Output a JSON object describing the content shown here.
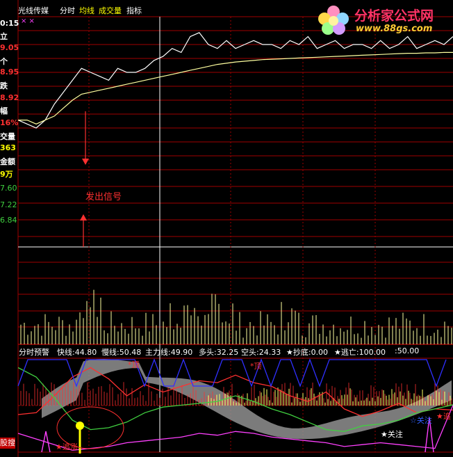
{
  "header": {
    "stock_name": "光线传媒",
    "tabs": [
      {
        "label": "分时",
        "color": "#ffffff"
      },
      {
        "label": "均线",
        "color": "#ffff00"
      },
      {
        "label": "成交量",
        "color": "#ffff00"
      },
      {
        "label": "指标",
        "color": "#ffffff"
      }
    ],
    "markers": "×    ×"
  },
  "watermark": {
    "title": "分析家公式网",
    "url": "www.88gs.com"
  },
  "left_panel": {
    "time": "0:15",
    "label_a": "立",
    "price_high": "9.05",
    "label_b": "个",
    "price_mid": "8.95",
    "label_c": "跌",
    "price_low": "8.92",
    "label_d": "幅",
    "change_pct": "16%",
    "volume_label": "交量",
    "volume_value": "363",
    "amount_label": "金额",
    "amount_value": "9万",
    "scale_1": "7.60",
    "scale_2": "7.22",
    "scale_3": "6.84",
    "button": "股搜"
  },
  "annotations": {
    "signal_text": "发出信号",
    "top_1": "*顶",
    "top_2": "*顶",
    "watch": "★关注",
    "chase": "★追涨",
    "chase_right": "★追",
    "bottom_right": "☆关注"
  },
  "legend": [
    {
      "text": "分时预警",
      "color": "#ffffff"
    },
    {
      "text": "快线:44.80",
      "color": "#ffffff"
    },
    {
      "text": "慢线:50.48",
      "color": "#ffffff"
    },
    {
      "text": "主力线:49.90",
      "color": "#ffffff"
    },
    {
      "text": "多头:32.25",
      "color": "#ffffff"
    },
    {
      "text": "空头:24.33",
      "color": "#ffffff"
    },
    {
      "text": "★抄底:0.00",
      "color": "#ffffff"
    },
    {
      "text": "★逃亡:100.00",
      "color": "#ffffff"
    },
    {
      "text": ":50.00",
      "color": "#ffffff"
    }
  ],
  "colors": {
    "background": "#000000",
    "grid": "#a00000",
    "price_line": "#ffffff",
    "avg_line": "#ffffa0",
    "volume": "#ffffa0",
    "fast_line": "#ff3030",
    "slow_line": "#40d040",
    "main_line": "#ff40ff",
    "band": "#909090",
    "blue_line": "#3030ff"
  },
  "chart_data": [
    {
      "type": "line",
      "name": "intraday price",
      "x": [
        0,
        5,
        10,
        15,
        20,
        25,
        30,
        35,
        40,
        45,
        50,
        55,
        60,
        65,
        70,
        75,
        80,
        85,
        90,
        95,
        100,
        105,
        110,
        115,
        120,
        125,
        130,
        135,
        140,
        145,
        150,
        155,
        160,
        165,
        170,
        175,
        180,
        185,
        190,
        195,
        200,
        205,
        210,
        215,
        220,
        225,
        230,
        235,
        240
      ],
      "series": [
        {
          "values": [
            8.84,
            8.83,
            8.82,
            8.84,
            8.88,
            8.91,
            8.94,
            8.97,
            8.96,
            8.95,
            8.94,
            8.97,
            8.96,
            8.96,
            8.97,
            8.99,
            9.0,
            9.02,
            9.01,
            9.05,
            9.06,
            9.03,
            9.02,
            9.04,
            9.02,
            9.03,
            9.04,
            9.03,
            9.03,
            9.02,
            9.04,
            9.03,
            9.05,
            9.02,
            9.03,
            9.04,
            9.02,
            9.03,
            9.03,
            9.02,
            9.04,
            9.02,
            9.03,
            9.05,
            9.02,
            9.03,
            9.04,
            9.03,
            9.05
          ]
        },
        {
          "values": [
            8.84,
            8.84,
            8.83,
            8.84,
            8.85,
            8.87,
            8.89,
            8.905,
            8.91,
            8.915,
            8.92,
            8.925,
            8.93,
            8.935,
            8.94,
            8.945,
            8.95,
            8.955,
            8.96,
            8.965,
            8.97,
            8.975,
            8.98,
            8.983,
            8.986,
            8.988,
            8.99,
            8.992,
            8.993,
            8.994,
            8.995,
            8.996,
            8.997,
            8.998,
            8.999,
            9.0,
            9.001,
            9.002,
            9.003,
            9.004,
            9.005,
            9.006,
            9.007,
            9.008,
            9.008,
            9.009,
            9.009,
            9.01,
            9.01
          ]
        }
      ],
      "ylim": [
        8.82,
        9.1
      ]
    },
    {
      "type": "bar",
      "name": "volume",
      "ylim": [
        0,
        1
      ]
    },
    {
      "type": "line",
      "name": "分时预警",
      "x": [
        0,
        10,
        20,
        30,
        40,
        50,
        60,
        70,
        80,
        90,
        100,
        110,
        120,
        130,
        140,
        150,
        160,
        170,
        180,
        190,
        200,
        210,
        220,
        230,
        240
      ],
      "series": [
        {
          "name": "快线",
          "values": [
            40,
            42,
            60,
            80,
            90,
            78,
            60,
            72,
            64,
            70,
            76,
            74,
            82,
            74,
            70,
            60,
            54,
            64,
            46,
            38,
            44,
            52,
            42,
            46,
            44.8
          ]
        },
        {
          "name": "慢线",
          "values": [
            90,
            80,
            58,
            34,
            24,
            26,
            32,
            42,
            48,
            50,
            52,
            54,
            60,
            54,
            46,
            40,
            32,
            24,
            22,
            28,
            30,
            34,
            42,
            46,
            50.48
          ]
        },
        {
          "name": "主力线",
          "values": [
            20,
            14,
            8,
            2,
            4,
            6,
            10,
            12,
            14,
            16,
            20,
            18,
            22,
            20,
            16,
            14,
            12,
            10,
            6,
            8,
            10,
            8,
            6,
            4,
            49.9
          ]
        }
      ],
      "ylim": [
        0,
        100
      ]
    }
  ]
}
